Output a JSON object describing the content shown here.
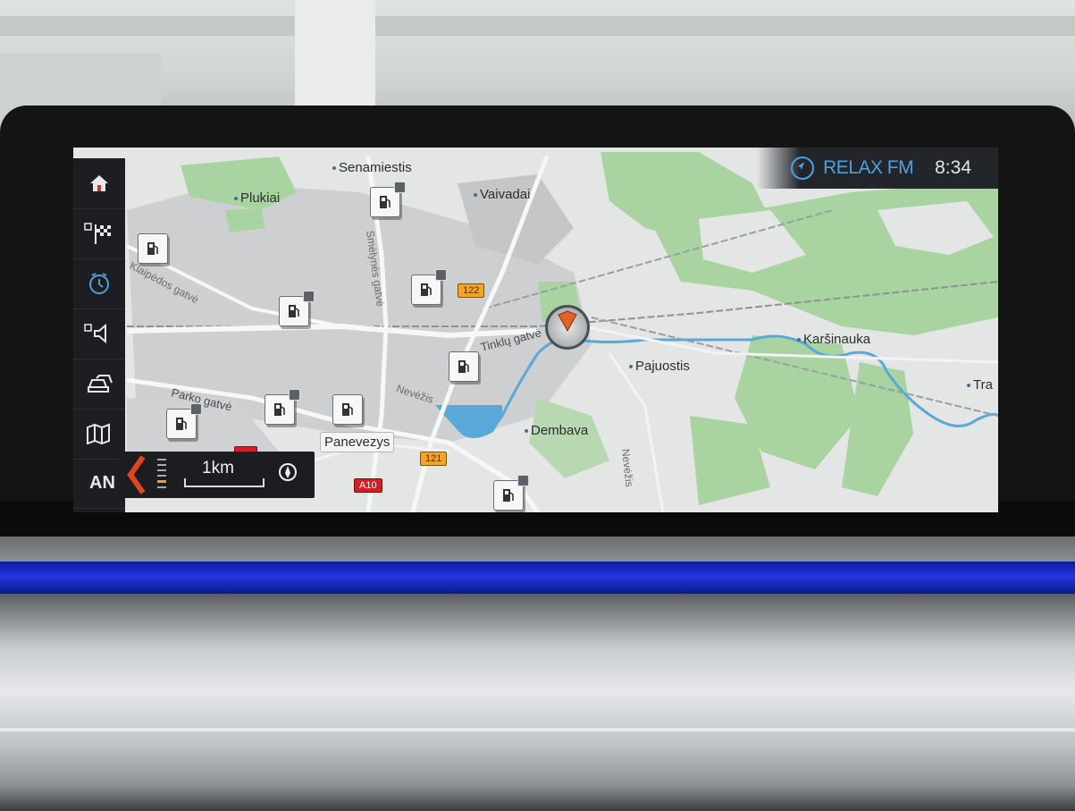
{
  "status": {
    "radio": "RELAX FM",
    "clock": "8:34"
  },
  "sidebar": {
    "items": [
      {
        "label": "",
        "icon": "home-icon"
      },
      {
        "label": "",
        "icon": "destination-flag-icon"
      },
      {
        "label": "",
        "icon": "timer-icon"
      },
      {
        "label": "",
        "icon": "speaker-icon"
      },
      {
        "label": "",
        "icon": "car-icon"
      },
      {
        "label": "",
        "icon": "map-icon"
      },
      {
        "label": "AN",
        "icon": ""
      }
    ]
  },
  "map": {
    "places": [
      "Senamiestis",
      "Plukiai",
      "Vaivadai",
      "Karšinauka",
      "Pajuostis",
      "Dembava",
      "Tra"
    ],
    "city": "Panevezys",
    "roads": [
      "Klaipėdos gatvė",
      "Tinklų gatvė",
      "Nevėžis",
      "Parko gatvė",
      "Smėlynės gatvė",
      "Nevėžis"
    ],
    "shields": [
      "122",
      "121",
      "A10"
    ],
    "scale": "1km"
  },
  "colors": {
    "accent": "#4fa0e0",
    "water": "#5aa8d8",
    "park": "#a8d5a2",
    "urban": "#c9cbcc"
  }
}
